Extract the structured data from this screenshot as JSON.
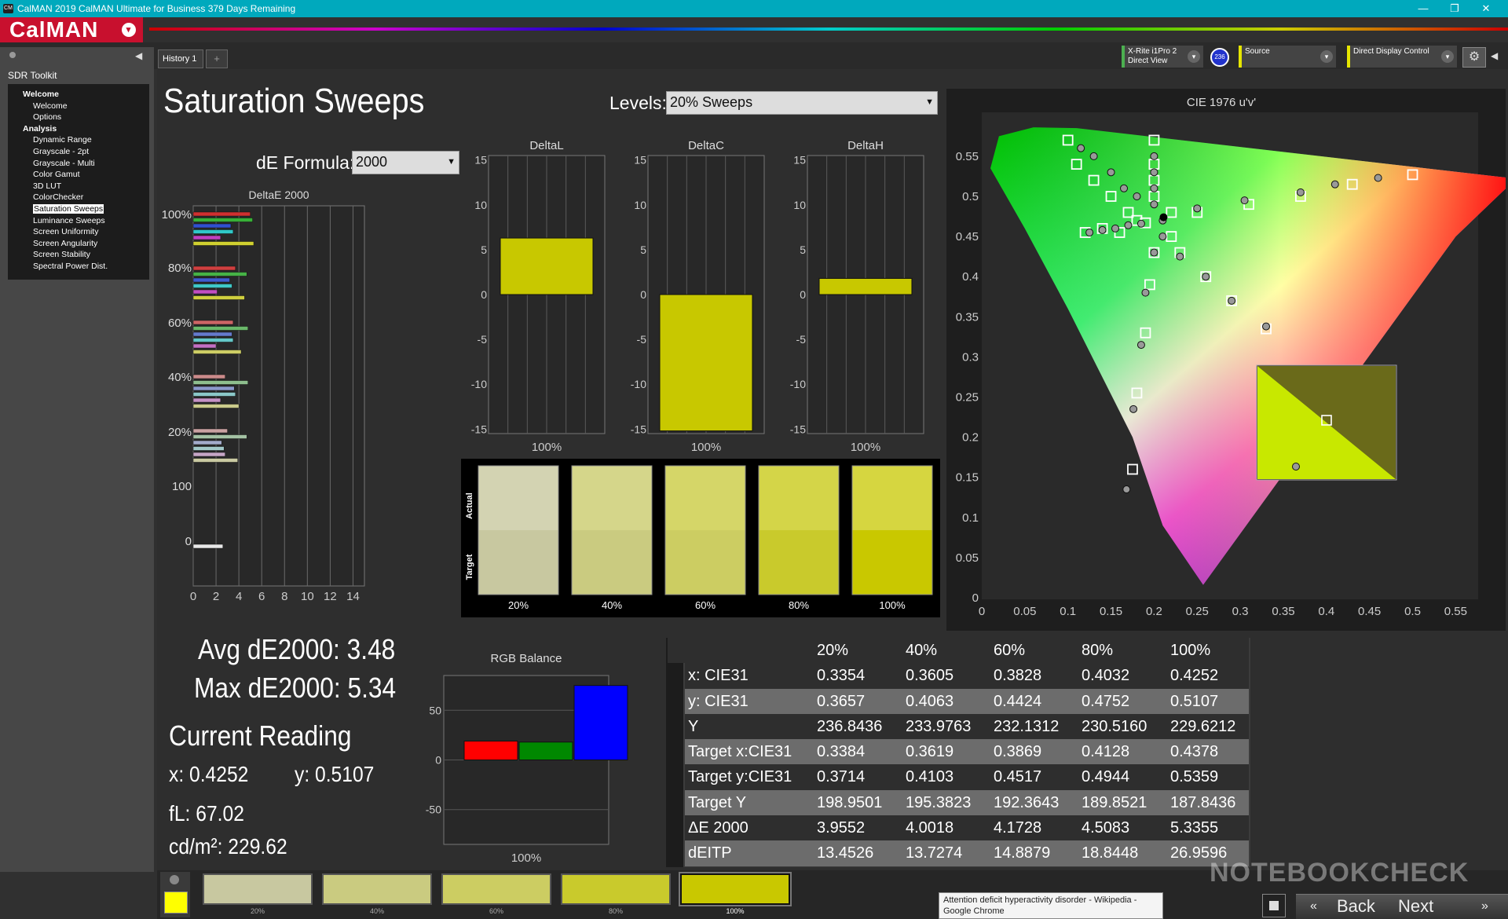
{
  "window": {
    "title": "CalMAN 2019 CalMAN Ultimate for Business 379 Days Remaining",
    "logo": "CM",
    "min": "—",
    "max": "❐",
    "close": "✕"
  },
  "brand": {
    "name": "CalMAN",
    "menu_icon": "▾"
  },
  "sidebar": {
    "title": "SDR Toolkit",
    "items": [
      {
        "label": "Welcome",
        "group": true
      },
      {
        "label": "Welcome"
      },
      {
        "label": "Options"
      },
      {
        "label": "Analysis",
        "group": true
      },
      {
        "label": "Dynamic Range"
      },
      {
        "label": "Grayscale - 2pt"
      },
      {
        "label": "Grayscale - Multi"
      },
      {
        "label": "Color Gamut"
      },
      {
        "label": "3D LUT"
      },
      {
        "label": "ColorChecker"
      },
      {
        "label": "Saturation Sweeps",
        "selected": true
      },
      {
        "label": "Luminance Sweeps"
      },
      {
        "label": "Screen Uniformity"
      },
      {
        "label": "Screen Angularity"
      },
      {
        "label": "Screen Stability"
      },
      {
        "label": "Spectral Power Dist."
      }
    ]
  },
  "tabs": {
    "history": "History 1",
    "add": "+"
  },
  "devices": {
    "meter_line1": "X-Rite i1Pro 2",
    "meter_line2": "Direct View",
    "meter_badge": "236",
    "source": "Source",
    "display": "Direct Display Control"
  },
  "page": {
    "title": "Saturation Sweeps",
    "levels_label": "Levels:",
    "levels_value": "20% Sweeps",
    "formula_label": "dE Formula:",
    "formula_value": "2000"
  },
  "deltae_chart": {
    "title": "DeltaE 2000",
    "x_ticks": [
      "0",
      "2",
      "4",
      "6",
      "8",
      "10",
      "12",
      "14"
    ],
    "group_labels": [
      "100%",
      "80%",
      "60%",
      "40%",
      "20%",
      "100",
      "0"
    ]
  },
  "delta_charts": [
    {
      "title": "DeltaL",
      "value": 6.3,
      "xlabel": "100%"
    },
    {
      "title": "DeltaC",
      "value": -15.2,
      "xlabel": "100%"
    },
    {
      "title": "DeltaH",
      "value": 1.8,
      "xlabel": "100%"
    }
  ],
  "delta_y_ticks": [
    "15",
    "10",
    "5",
    "0",
    "-5",
    "-10",
    "-15"
  ],
  "patches": {
    "actual_label": "Actual",
    "target_label": "Target",
    "items": [
      {
        "label": "20%",
        "actual": "#d3d3b2",
        "target": "#c8c8a0"
      },
      {
        "label": "40%",
        "actual": "#d5d68a",
        "target": "#cacb80"
      },
      {
        "label": "60%",
        "actual": "#d5d668",
        "target": "#cccd62"
      },
      {
        "label": "80%",
        "actual": "#d4d548",
        "target": "#c9ca2c"
      },
      {
        "label": "100%",
        "actual": "#d6d640",
        "target": "#c9c800"
      }
    ]
  },
  "cie": {
    "title": "CIE 1976 u'v'",
    "x_ticks": [
      "0",
      "0.05",
      "0.1",
      "0.15",
      "0.2",
      "0.25",
      "0.3",
      "0.35",
      "0.4",
      "0.45",
      "0.5",
      "0.55"
    ],
    "y_ticks": [
      "0",
      "0.05",
      "0.1",
      "0.15",
      "0.2",
      "0.25",
      "0.3",
      "0.35",
      "0.4",
      "0.45",
      "0.5",
      "0.55"
    ]
  },
  "stats": {
    "avg": "Avg dE2000: 3.48",
    "max": "Max dE2000: 5.34",
    "current_title": "Current Reading",
    "x": "x: 0.4252",
    "y": "y: 0.5107",
    "fl": "fL: 67.02",
    "cd": "cd/m²: 229.62"
  },
  "rgb_balance": {
    "title": "RGB Balance",
    "values": {
      "r": 19,
      "g": 18,
      "b": 75
    },
    "y_ticks": [
      "50",
      "0",
      "-50"
    ],
    "xlabel": "100%"
  },
  "table": {
    "columns": [
      "20%",
      "40%",
      "60%",
      "80%",
      "100%"
    ],
    "rows": [
      {
        "label": "x: CIE31",
        "values": [
          "0.3354",
          "0.3605",
          "0.3828",
          "0.4032",
          "0.4252"
        ]
      },
      {
        "label": "y: CIE31",
        "values": [
          "0.3657",
          "0.4063",
          "0.4424",
          "0.4752",
          "0.5107"
        ]
      },
      {
        "label": "Y",
        "values": [
          "236.8436",
          "233.9763",
          "232.1312",
          "230.5160",
          "229.6212"
        ]
      },
      {
        "label": "Target x:CIE31",
        "values": [
          "0.3384",
          "0.3619",
          "0.3869",
          "0.4128",
          "0.4378"
        ]
      },
      {
        "label": "Target y:CIE31",
        "values": [
          "0.3714",
          "0.4103",
          "0.4517",
          "0.4944",
          "0.5359"
        ]
      },
      {
        "label": "Target Y",
        "values": [
          "198.9501",
          "195.3823",
          "192.3643",
          "189.8521",
          "187.8436"
        ]
      },
      {
        "label": "ΔE 2000",
        "values": [
          "3.9552",
          "4.0018",
          "4.1728",
          "4.5083",
          "5.3355"
        ]
      },
      {
        "label": "dEITP",
        "values": [
          "13.4526",
          "13.7274",
          "14.8879",
          "18.8448",
          "26.9596"
        ]
      }
    ]
  },
  "bottom": {
    "swatches": [
      {
        "label": "20%",
        "color": "#c8c8a0"
      },
      {
        "label": "40%",
        "color": "#cacb80"
      },
      {
        "label": "60%",
        "color": "#cccd62"
      },
      {
        "label": "80%",
        "color": "#c9ca2c"
      },
      {
        "label": "100%",
        "color": "#c9c800"
      }
    ],
    "tooltip": "Attention deficit hyperactivity disorder - Wikipedia - Google Chrome",
    "back": "Back",
    "next": "Next",
    "watermark": "NOTEBOOKCHECK"
  },
  "colors": {
    "accent": "#c8102e",
    "titlebar": "#00a9bd",
    "bar_yellow": "#c8c800"
  }
}
